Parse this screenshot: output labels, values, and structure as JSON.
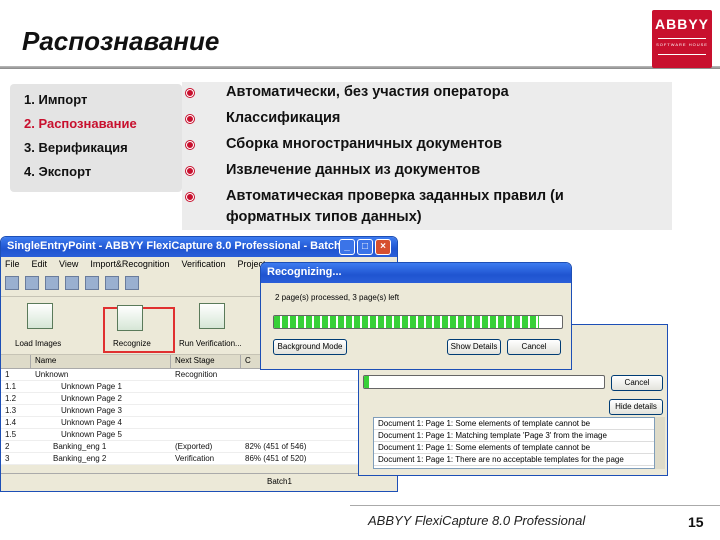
{
  "slide": {
    "title": "Распознавание",
    "logo": {
      "name": "ABBYY",
      "tagline": "SOFTWARE HOUSE"
    },
    "steps": [
      {
        "num": "1.",
        "label": "Импорт"
      },
      {
        "num": "2.",
        "label": "Распознавание"
      },
      {
        "num": "3.",
        "label": "Верификация"
      },
      {
        "num": "4.",
        "label": "Экспорт"
      }
    ],
    "bullets": [
      "Автоматически, без участия оператора",
      "Классификация",
      "Сборка многостраничных документов",
      "Извлечение данных из документов",
      "Автоматическая проверка заданных правил (и",
      "форматных типов данных)"
    ],
    "footer": "ABBYY FlexiCapture 8.0 Professional",
    "page_number": "15"
  },
  "main_window": {
    "title": "SingleEntryPoint - ABBYY FlexiCapture 8.0 Professional - Batch1",
    "menu": [
      "File",
      "Edit",
      "View",
      "Import&Recognition",
      "Verification",
      "Project"
    ],
    "tools": {
      "load": "Load Images",
      "recognize": "Recognize",
      "verify": "Run Verification..."
    },
    "columns": [
      "",
      "Name",
      "Next Stage",
      "C"
    ],
    "rows": [
      {
        "id": "1",
        "name": "Unknown",
        "stage": "Recognition",
        "status": ""
      },
      {
        "id": "1.1",
        "name": "Unknown Page 1",
        "stage": "",
        "status": ""
      },
      {
        "id": "1.2",
        "name": "Unknown Page 2",
        "stage": "",
        "status": ""
      },
      {
        "id": "1.3",
        "name": "Unknown Page 3",
        "stage": "",
        "status": ""
      },
      {
        "id": "1.4",
        "name": "Unknown Page 4",
        "stage": "",
        "status": ""
      },
      {
        "id": "1.5",
        "name": "Unknown Page 5",
        "stage": "",
        "status": ""
      },
      {
        "id": "2",
        "name": "Banking_eng 1",
        "stage": "(Exported)",
        "status": "82% (451 of 546)"
      },
      {
        "id": "3",
        "name": "Banking_eng 2",
        "stage": "Verification",
        "status": "86% (451 of 520)"
      }
    ],
    "status": "Batch1"
  },
  "recognizing_dialog": {
    "title": "Recognizing...",
    "message": "2 page(s) processed, 3 page(s) left",
    "progress": 0.92,
    "buttons": {
      "background": "Background Mode",
      "details": "Show Details",
      "cancel": "Cancel"
    }
  },
  "details_dialog": {
    "progress": 0.02,
    "buttons": {
      "cancel": "Cancel",
      "hide": "Hide details"
    },
    "log": [
      "Document 1: Page 1: Some elements of template cannot be",
      "Document 1: Page 1: Matching template 'Page 3' from the image",
      "Document 1: Page 1: Some elements of template cannot be",
      "Document 1: Page 1: There are no acceptable templates for the page"
    ]
  }
}
